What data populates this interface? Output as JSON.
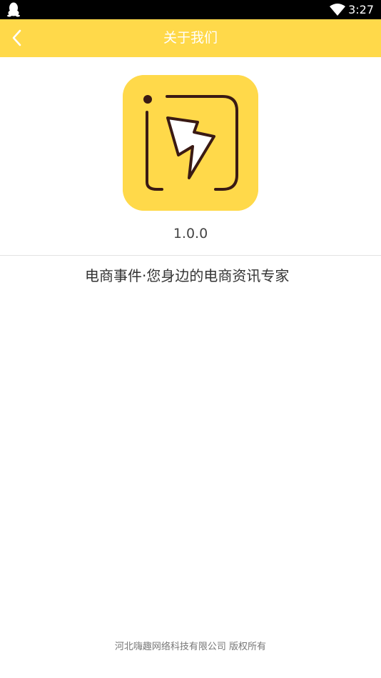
{
  "status_bar": {
    "time": "3:27",
    "icons": [
      "qq-icon",
      "wifi-icon"
    ]
  },
  "app_bar": {
    "title": "关于我们",
    "back_icon": "chevron-left-icon",
    "background_color": "#ffd94a",
    "title_color": "#ffffff"
  },
  "about": {
    "logo_icon": "app-logo-lightning-icon",
    "version": "1.0.0",
    "slogan": "电商事件·您身边的电商资讯专家"
  },
  "footer": {
    "copyright": "河北嗨趣网络科技有限公司 版权所有"
  }
}
